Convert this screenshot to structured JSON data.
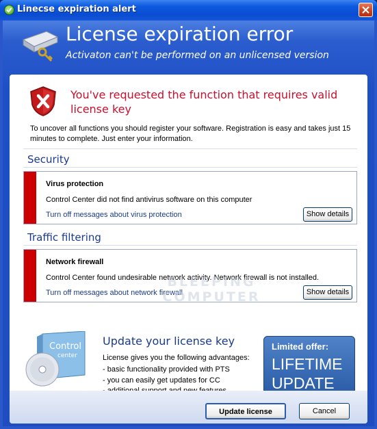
{
  "window": {
    "title": "Linecse expiration alert",
    "icons": {
      "app": "check-circle-icon",
      "close": "close-icon"
    }
  },
  "header": {
    "title": "License expiration error",
    "subtitle": "Activaton can't be performed on an unlicensed version",
    "icon": "hard-drive-keys-icon"
  },
  "message": {
    "icon": "shield-error-icon",
    "title": "You've requested the function that requires valid license key",
    "intro": "To uncover all functions you should register your software. Registration is easy and takes just 15 minutes to complete. Just enter your information."
  },
  "sections": [
    {
      "title": "Security",
      "alert_title": "Virus protection",
      "alert_text": "Control Center did not find antivirus software on this computer",
      "link": "Turn off messages about virus protection",
      "button": "Show details"
    },
    {
      "title": "Traffic filtering",
      "alert_title": "Network firewall",
      "alert_text": "Control Center found undesirable network activity. Network firewall is not installed.",
      "link": "Turn off messages about network firewall",
      "button": "Show details"
    }
  ],
  "product": {
    "box_text": "Control center",
    "icon": "software-box-cd-icon"
  },
  "update": {
    "title": "Update your license key",
    "subtitle": "License gives you the following advantages:",
    "items": [
      "- basic functionality provided with PTS",
      "- you can easily get updates for CC",
      "- additional support and new features"
    ]
  },
  "offer": {
    "label": "Limited offer:",
    "big": "LIFETIME UPDATE"
  },
  "watermark": "BLEEPING COMPUTER",
  "buttons": {
    "update": "Update license",
    "cancel": "Cancel"
  },
  "colors": {
    "title_bar": "#0a4cd1",
    "accent_red": "#c8102e",
    "link_blue": "#1a3a8c",
    "alert_bar": "#cc0000"
  }
}
